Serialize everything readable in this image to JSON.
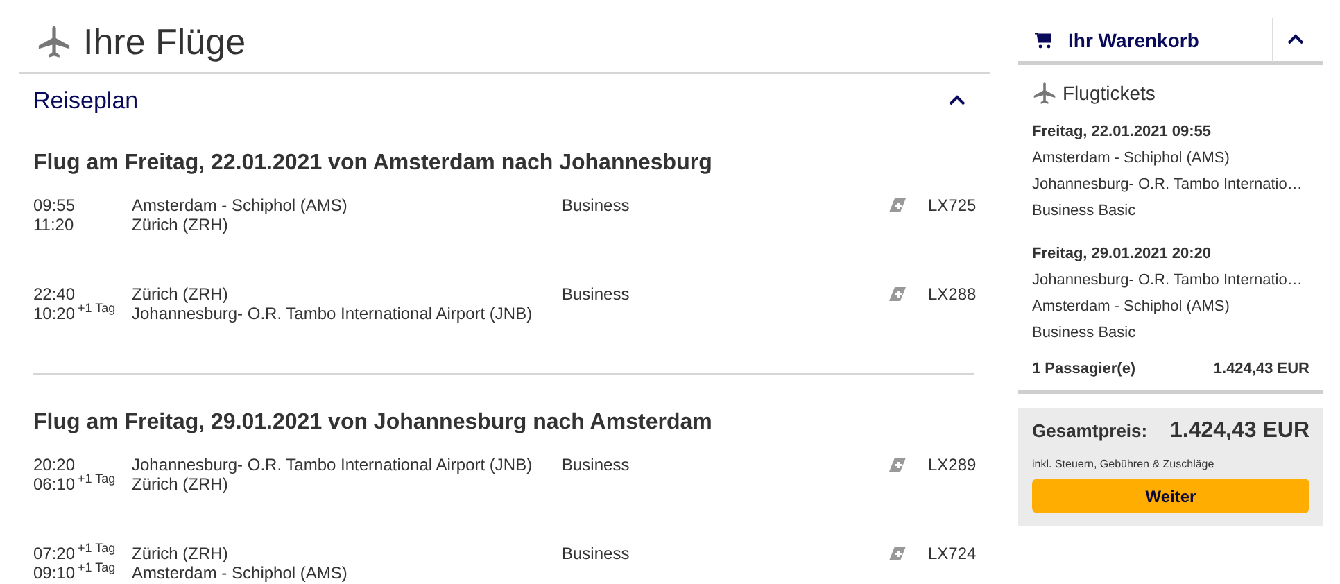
{
  "page_title": "Ihre Flüge",
  "itinerary": {
    "title": "Reiseplan",
    "expanded": true,
    "flights": [
      {
        "heading": "Flug am Freitag, 22.01.2021 von Amsterdam nach Johannesburg",
        "segments": [
          {
            "dep_time": "09:55",
            "arr_time": "11:20",
            "from": "Amsterdam - Schiphol (AMS)",
            "to": "Zürich (ZRH)",
            "cabin": "Business",
            "flight": "LX725"
          },
          {
            "dep_time": "22:40",
            "arr_time": "10:20",
            "arr_note": "+1 Tag",
            "from": "Zürich (ZRH)",
            "to": "Johannesburg- O.R. Tambo International Airport (JNB)",
            "cabin": "Business",
            "flight": "LX288"
          }
        ]
      },
      {
        "heading": "Flug am Freitag, 29.01.2021 von Johannesburg nach Amsterdam",
        "segments": [
          {
            "dep_time": "20:20",
            "arr_time": "06:10",
            "arr_note": "+1 Tag",
            "from": "Johannesburg- O.R. Tambo International Airport (JNB)",
            "to": "Zürich (ZRH)",
            "cabin": "Business",
            "flight": "LX289"
          },
          {
            "dep_time": "07:20",
            "dep_note": "+1 Tag",
            "arr_time": "09:10",
            "arr_note": "+1 Tag",
            "from": "Zürich (ZRH)",
            "to": "Amsterdam - Schiphol (AMS)",
            "cabin": "Business",
            "flight": "LX724"
          }
        ]
      }
    ]
  },
  "cart": {
    "title": "Ihr Warenkorb",
    "expanded": true,
    "section": "Flugtickets",
    "tickets": [
      {
        "date": "Freitag, 22.01.2021 09:55",
        "from": "Amsterdam - Schiphol (AMS)",
        "to": "Johannesburg- O.R. Tambo Internatio…",
        "fare": "Business Basic"
      },
      {
        "date": "Freitag, 29.01.2021 20:20",
        "from": "Johannesburg- O.R. Tambo Internatio…",
        "to": "Amsterdam - Schiphol (AMS)",
        "fare": "Business Basic"
      }
    ],
    "passengers": "1 Passagier(e)",
    "subtotal": "1.424,43 EUR",
    "total_label": "Gesamtpreis:",
    "total": "1.424,43 EUR",
    "total_note": "inkl. Steuern, Gebühren & Zuschläge",
    "button": "Weiter"
  }
}
